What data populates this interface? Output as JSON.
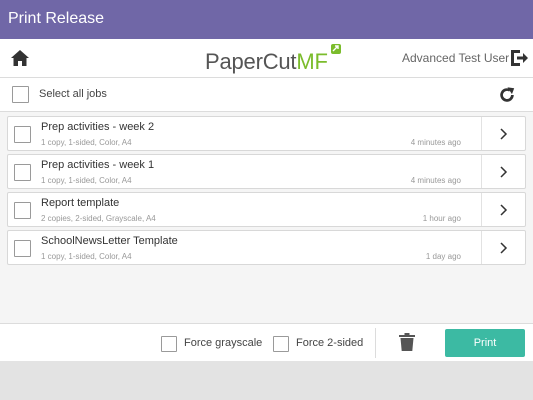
{
  "titlebar": {
    "title": "Print Release"
  },
  "header": {
    "logo_main": "PaperCut",
    "logo_accent": "MF",
    "user_name": "Advanced Test User",
    "icons": {
      "home": "home-icon",
      "logout": "logout-icon"
    }
  },
  "select_all": {
    "label": "Select all jobs",
    "checked": false,
    "refresh_icon": "refresh-icon"
  },
  "jobs": [
    {
      "name": "Prep activities - week 2",
      "details": "1 copy, 1-sided, Color, A4",
      "time": "4 minutes ago",
      "checked": false
    },
    {
      "name": "Prep activities - week 1",
      "details": "1 copy, 1-sided, Color, A4",
      "time": "4 minutes ago",
      "checked": false
    },
    {
      "name": "Report template",
      "details": "2 copies, 2-sided, Grayscale, A4",
      "time": "1 hour ago",
      "checked": false
    },
    {
      "name": "SchoolNewsLetter Template",
      "details": "1 copy, 1-sided, Color, A4",
      "time": "1 day ago",
      "checked": false
    }
  ],
  "footer": {
    "force_grayscale": {
      "label": "Force grayscale",
      "checked": false
    },
    "force_2sided": {
      "label": "Force 2-sided",
      "checked": false
    },
    "delete_icon": "trash-icon",
    "print_label": "Print"
  },
  "colors": {
    "titlebar": "#7067a7",
    "accent_button": "#3cbaa3",
    "logo_accent": "#7bbc2c"
  }
}
